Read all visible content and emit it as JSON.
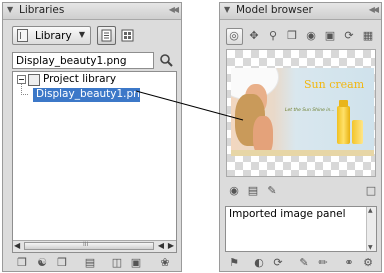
{
  "libraries": {
    "title": "Libraries",
    "dropdown_label": "Library",
    "search_value": "Display_beauty1.png",
    "tree": {
      "root_label": "Project library",
      "selected_item": "Display_beauty1.png"
    },
    "scroll_mid": "III"
  },
  "model_browser": {
    "title": "Model browser",
    "preview": {
      "headline": "Sun cream",
      "tagline": "Let the Sun Shine in..."
    },
    "description": "Imported image panel"
  },
  "colors": {
    "panel_bg": "#dcdcdc",
    "selection": "#3c78c8",
    "preview_bg": "#d9e7ee",
    "accent": "#f5c81e"
  }
}
